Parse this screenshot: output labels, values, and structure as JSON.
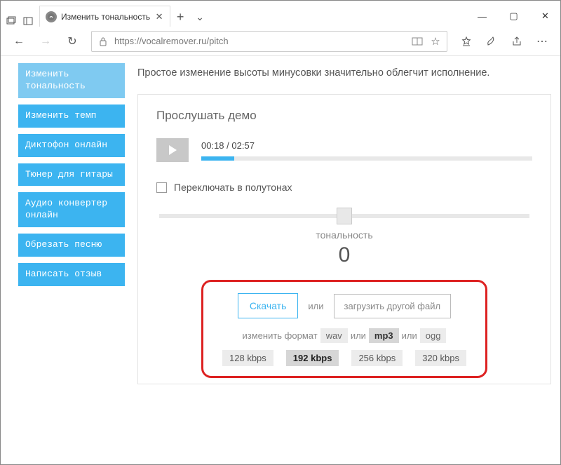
{
  "window": {
    "tab_title": "Изменить тональность",
    "url": "https://vocalremover.ru/pitch"
  },
  "sidebar": {
    "items": [
      {
        "label": "Изменить тональность",
        "active": true
      },
      {
        "label": "Изменить темп",
        "active": false
      },
      {
        "label": "Диктофон онлайн",
        "active": false
      },
      {
        "label": "Тюнер для гитары",
        "active": false
      },
      {
        "label": "Аудио конвертер онлайн",
        "active": false
      },
      {
        "label": "Обрезать песню",
        "active": false
      },
      {
        "label": "Написать отзыв",
        "active": false
      }
    ]
  },
  "main": {
    "subtitle": "Простое изменение высоты минусовки значительно облегчит исполнение.",
    "panel_title": "Прослушать демо",
    "player": {
      "current": "00:18",
      "total": "02:57",
      "progress_percent": 10
    },
    "semitone_checkbox": "Переключать в полутонах",
    "slider": {
      "label": "тональность",
      "value": "0",
      "position_percent": 50
    },
    "download": {
      "download_btn": "Скачать",
      "or": "или",
      "upload_btn": "загрузить другой файл",
      "format_label": "изменить формат",
      "formats": [
        "wav",
        "mp3",
        "ogg"
      ],
      "format_or": "или",
      "selected_format": "mp3",
      "bitrates": [
        "128 kbps",
        "192 kbps",
        "256 kbps",
        "320 kbps"
      ],
      "selected_bitrate": "192 kbps"
    }
  }
}
